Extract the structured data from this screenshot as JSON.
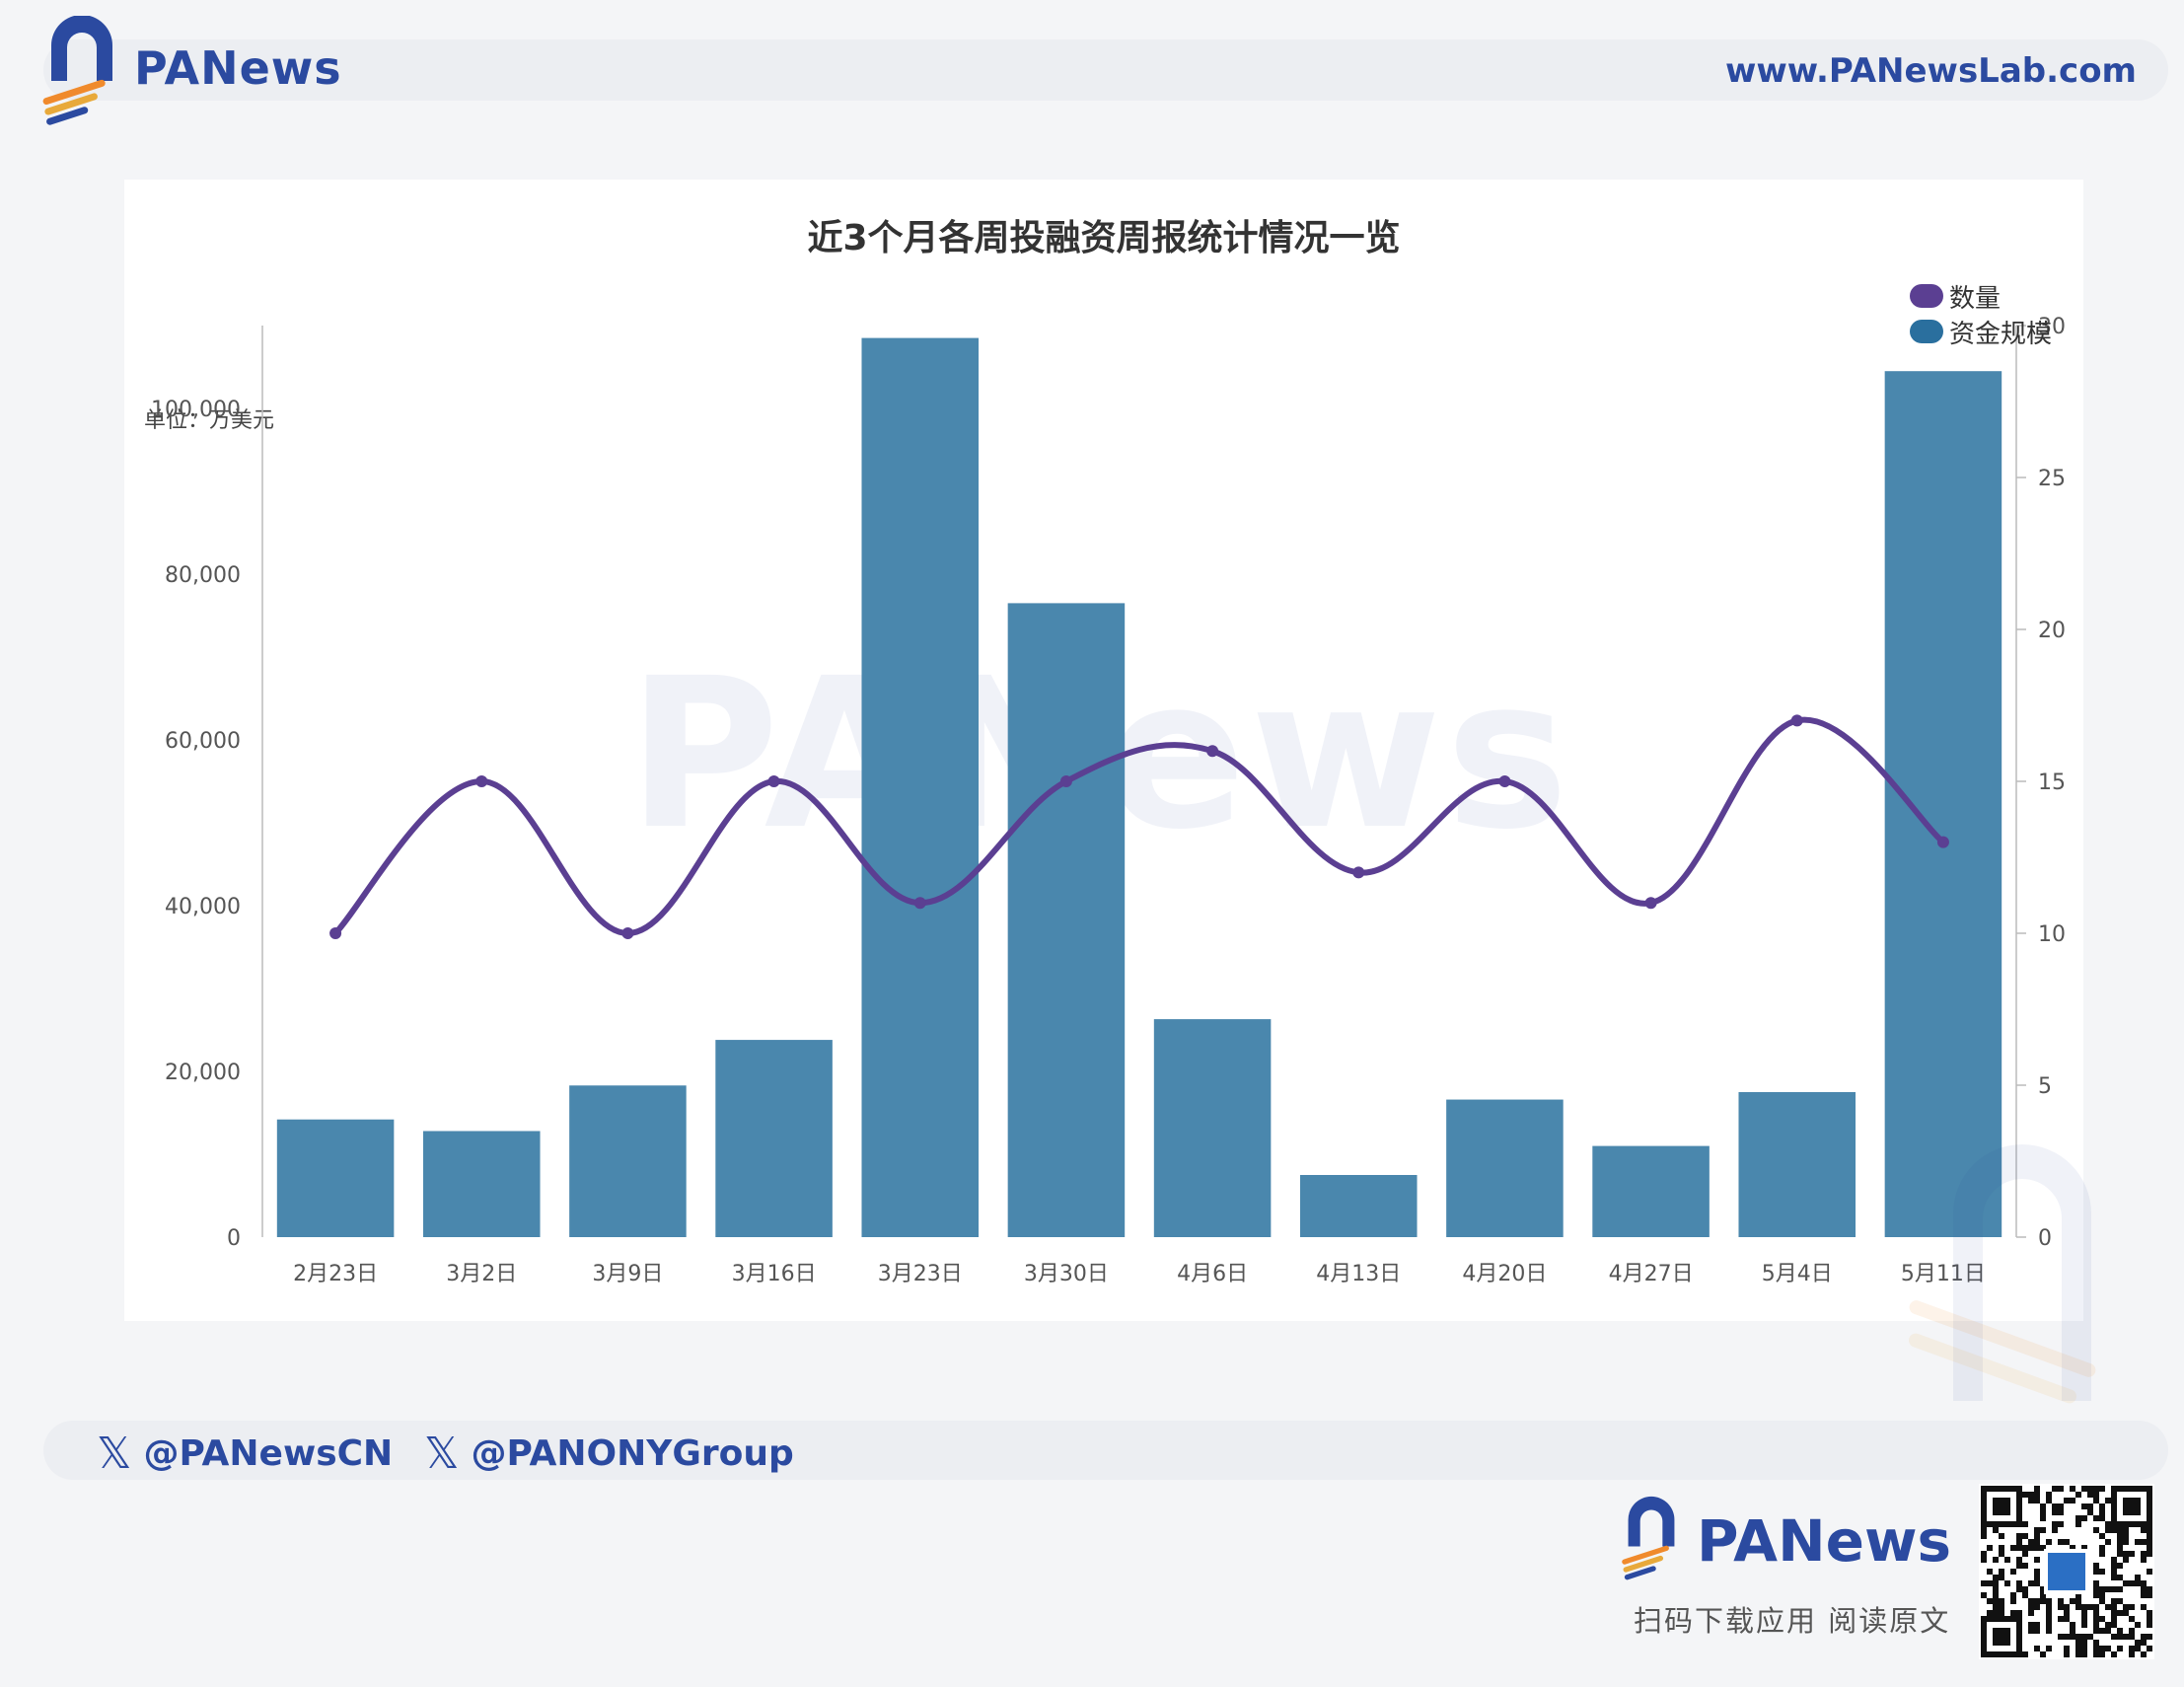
{
  "header": {
    "brand": "PANews",
    "site_url": "www.PANewsLab.com"
  },
  "chart_data": {
    "type": "bar",
    "title": "近3个月各周投融资周报统计情况一览",
    "unit_label": "单位：万美元",
    "categories": [
      "2月23日",
      "3月2日",
      "3月9日",
      "3月16日",
      "3月23日",
      "3月30日",
      "4月6日",
      "4月13日",
      "4月20日",
      "4月27日",
      "5月4日",
      "5月11日"
    ],
    "series": [
      {
        "name": "资金规模",
        "type": "bar",
        "axis": "left",
        "color": "#4a87ad",
        "values": [
          14200,
          12800,
          18300,
          23800,
          108500,
          76500,
          26300,
          7500,
          16600,
          11000,
          17500,
          104500
        ]
      },
      {
        "name": "数量",
        "type": "line",
        "axis": "right",
        "color": "#5b3f92",
        "smooth": true,
        "values": [
          10,
          15,
          10,
          15,
          11,
          15,
          16,
          12,
          15,
          11,
          17,
          13
        ]
      }
    ],
    "y_left": {
      "ticks": [
        "0",
        "20,000",
        "40,000",
        "60,000",
        "80,000",
        "100,000"
      ],
      "range": [
        0,
        110000
      ]
    },
    "y_right": {
      "ticks": [
        "0",
        "5",
        "10",
        "15",
        "20",
        "25",
        "30"
      ],
      "range": [
        0,
        30
      ]
    },
    "legend_position": "top-right"
  },
  "watermark": "PANews",
  "social": {
    "handle_1": "@PANewsCN",
    "handle_2": "@PANONYGroup"
  },
  "footer": {
    "brand": "PANews",
    "subtitle": "扫码下载应用  阅读原文"
  },
  "colors": {
    "brand_blue": "#2b4aa0",
    "bar": "#4a87ad",
    "line": "#5b3f92",
    "accent_orange": "#f08a2c"
  }
}
